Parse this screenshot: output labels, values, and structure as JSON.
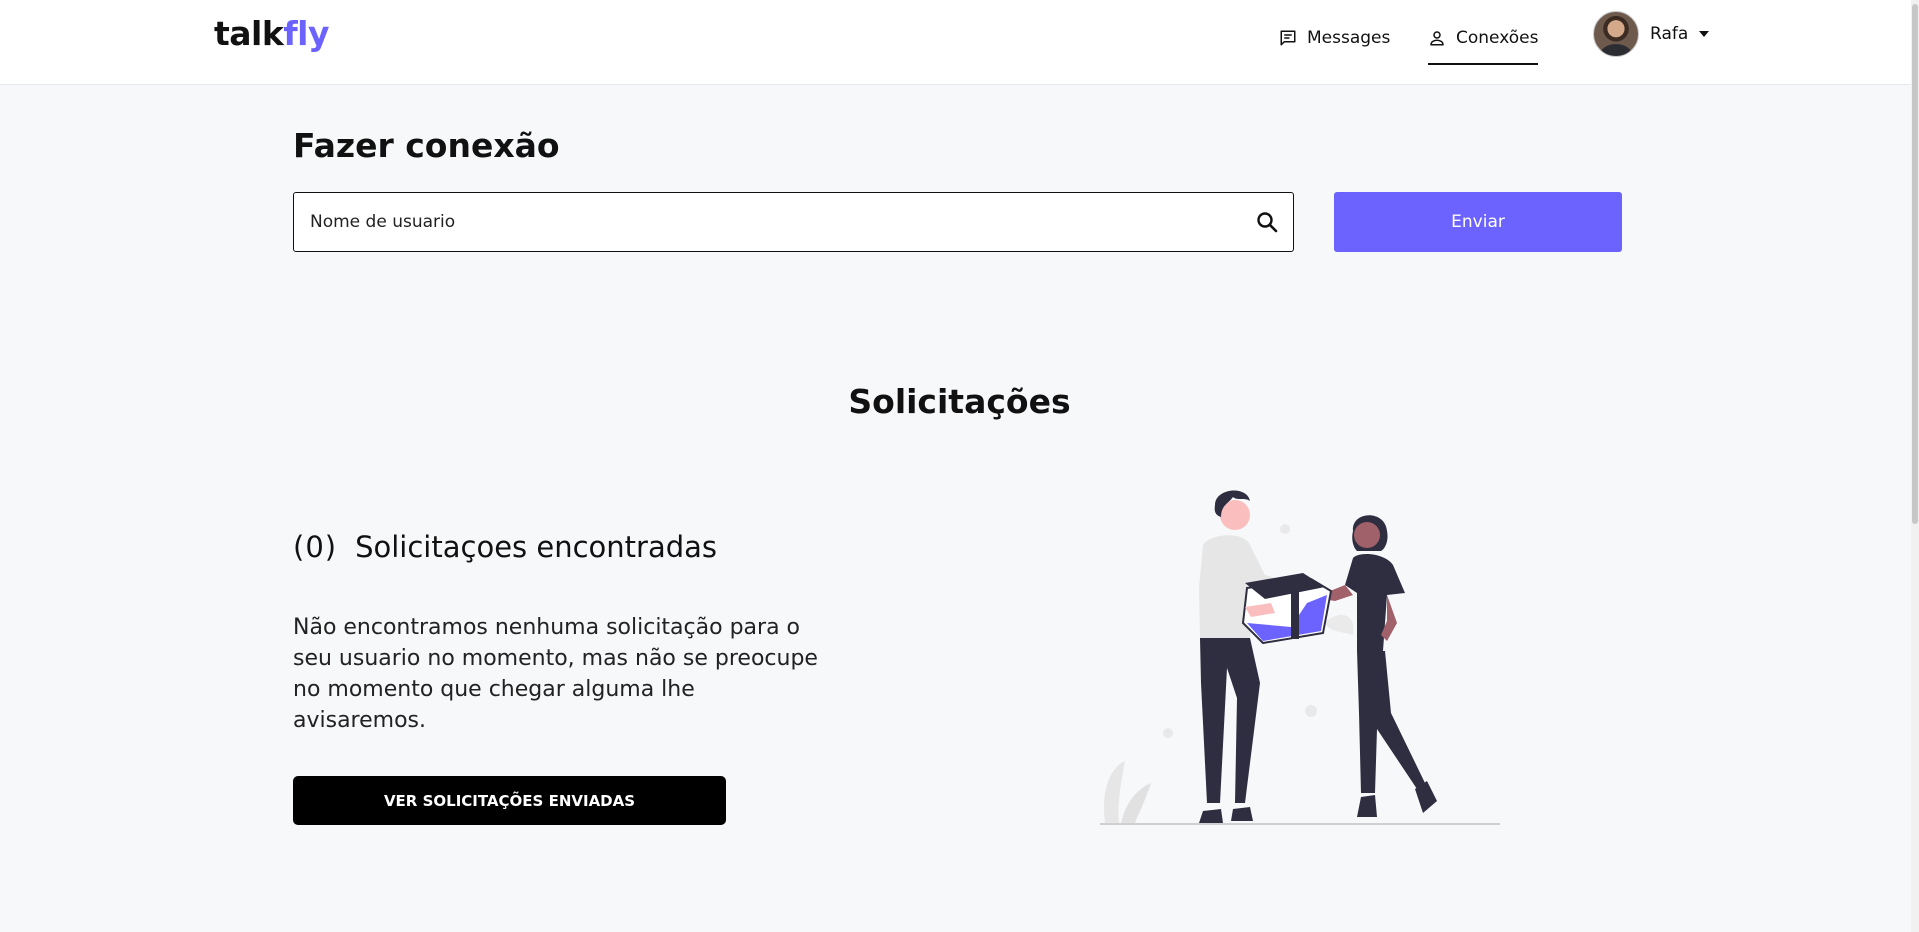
{
  "header": {
    "logo_part1": "talk",
    "logo_part2": "fly",
    "nav": [
      {
        "label": "Messages",
        "icon": "message-icon"
      },
      {
        "label": "Conexões",
        "icon": "user-icon",
        "active": true
      }
    ],
    "user_name": "Rafa"
  },
  "connect": {
    "title": "Fazer conexão",
    "search_placeholder": "Nome de usuario",
    "search_value": "",
    "send_label": "Enviar"
  },
  "requests": {
    "title": "Solicitações",
    "count": "(0)",
    "found_label": "Solicitaçoes encontradas",
    "empty_message": "Não encontramos nenhuma solicitação para o seu usuario no momento, mas não se preocupe no momento que chegar alguma lhe avisaremos.",
    "sent_button": "VER SOLICITAÇÕES ENVIADAS"
  },
  "colors": {
    "accent": "#6c63ff",
    "page_bg": "#f7f8fa",
    "dark": "#000000"
  }
}
